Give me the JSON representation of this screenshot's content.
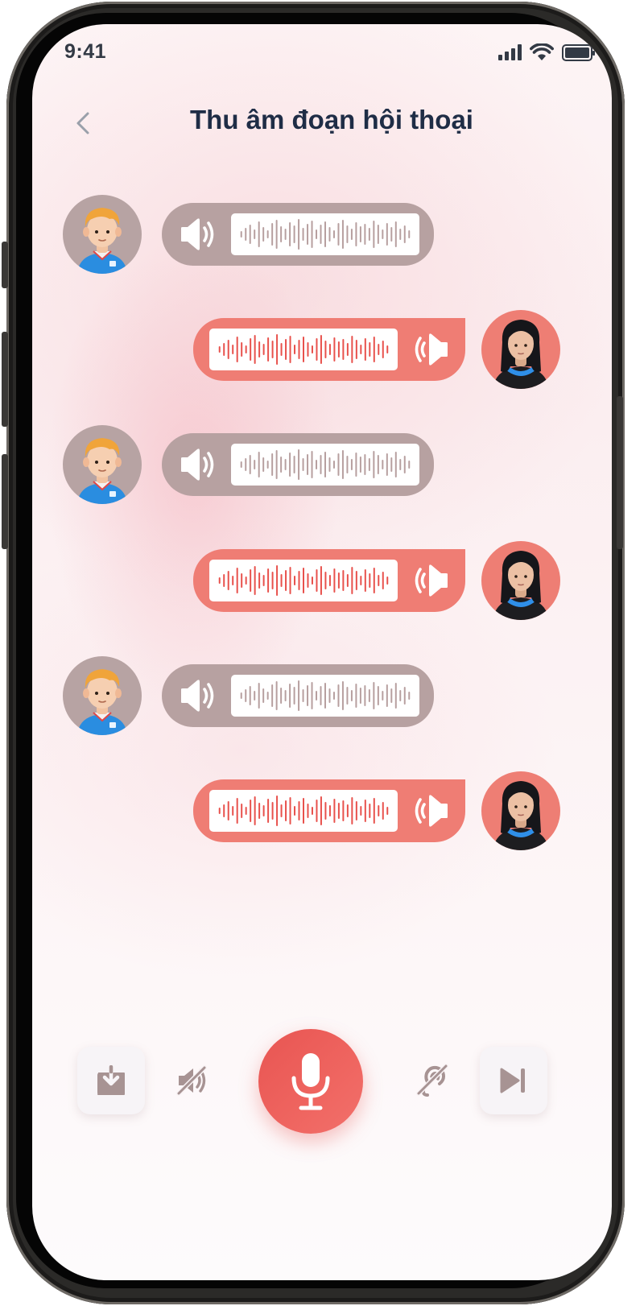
{
  "status_bar": {
    "time": "9:41"
  },
  "header": {
    "title": "Thu âm đoạn hội thoại"
  },
  "messages": [
    {
      "speaker": "boy",
      "side": "left"
    },
    {
      "speaker": "girl",
      "side": "right"
    },
    {
      "speaker": "boy",
      "side": "left"
    },
    {
      "speaker": "girl",
      "side": "right"
    },
    {
      "speaker": "boy",
      "side": "left"
    },
    {
      "speaker": "girl",
      "side": "right"
    }
  ],
  "icons": {
    "back": "chevron-left-icon",
    "speaker": "speaker-icon",
    "download": "download-icon",
    "mute": "speaker-muted-icon",
    "mic": "microphone-icon",
    "hearing": "hearing-disabled-icon",
    "skip": "skip-next-icon"
  },
  "colors": {
    "accent": "#ef7d74",
    "mic_button": "#e85552",
    "left_bubble": "#b7a1a1",
    "title": "#1f2d46",
    "icon_muted": "#a79393"
  }
}
